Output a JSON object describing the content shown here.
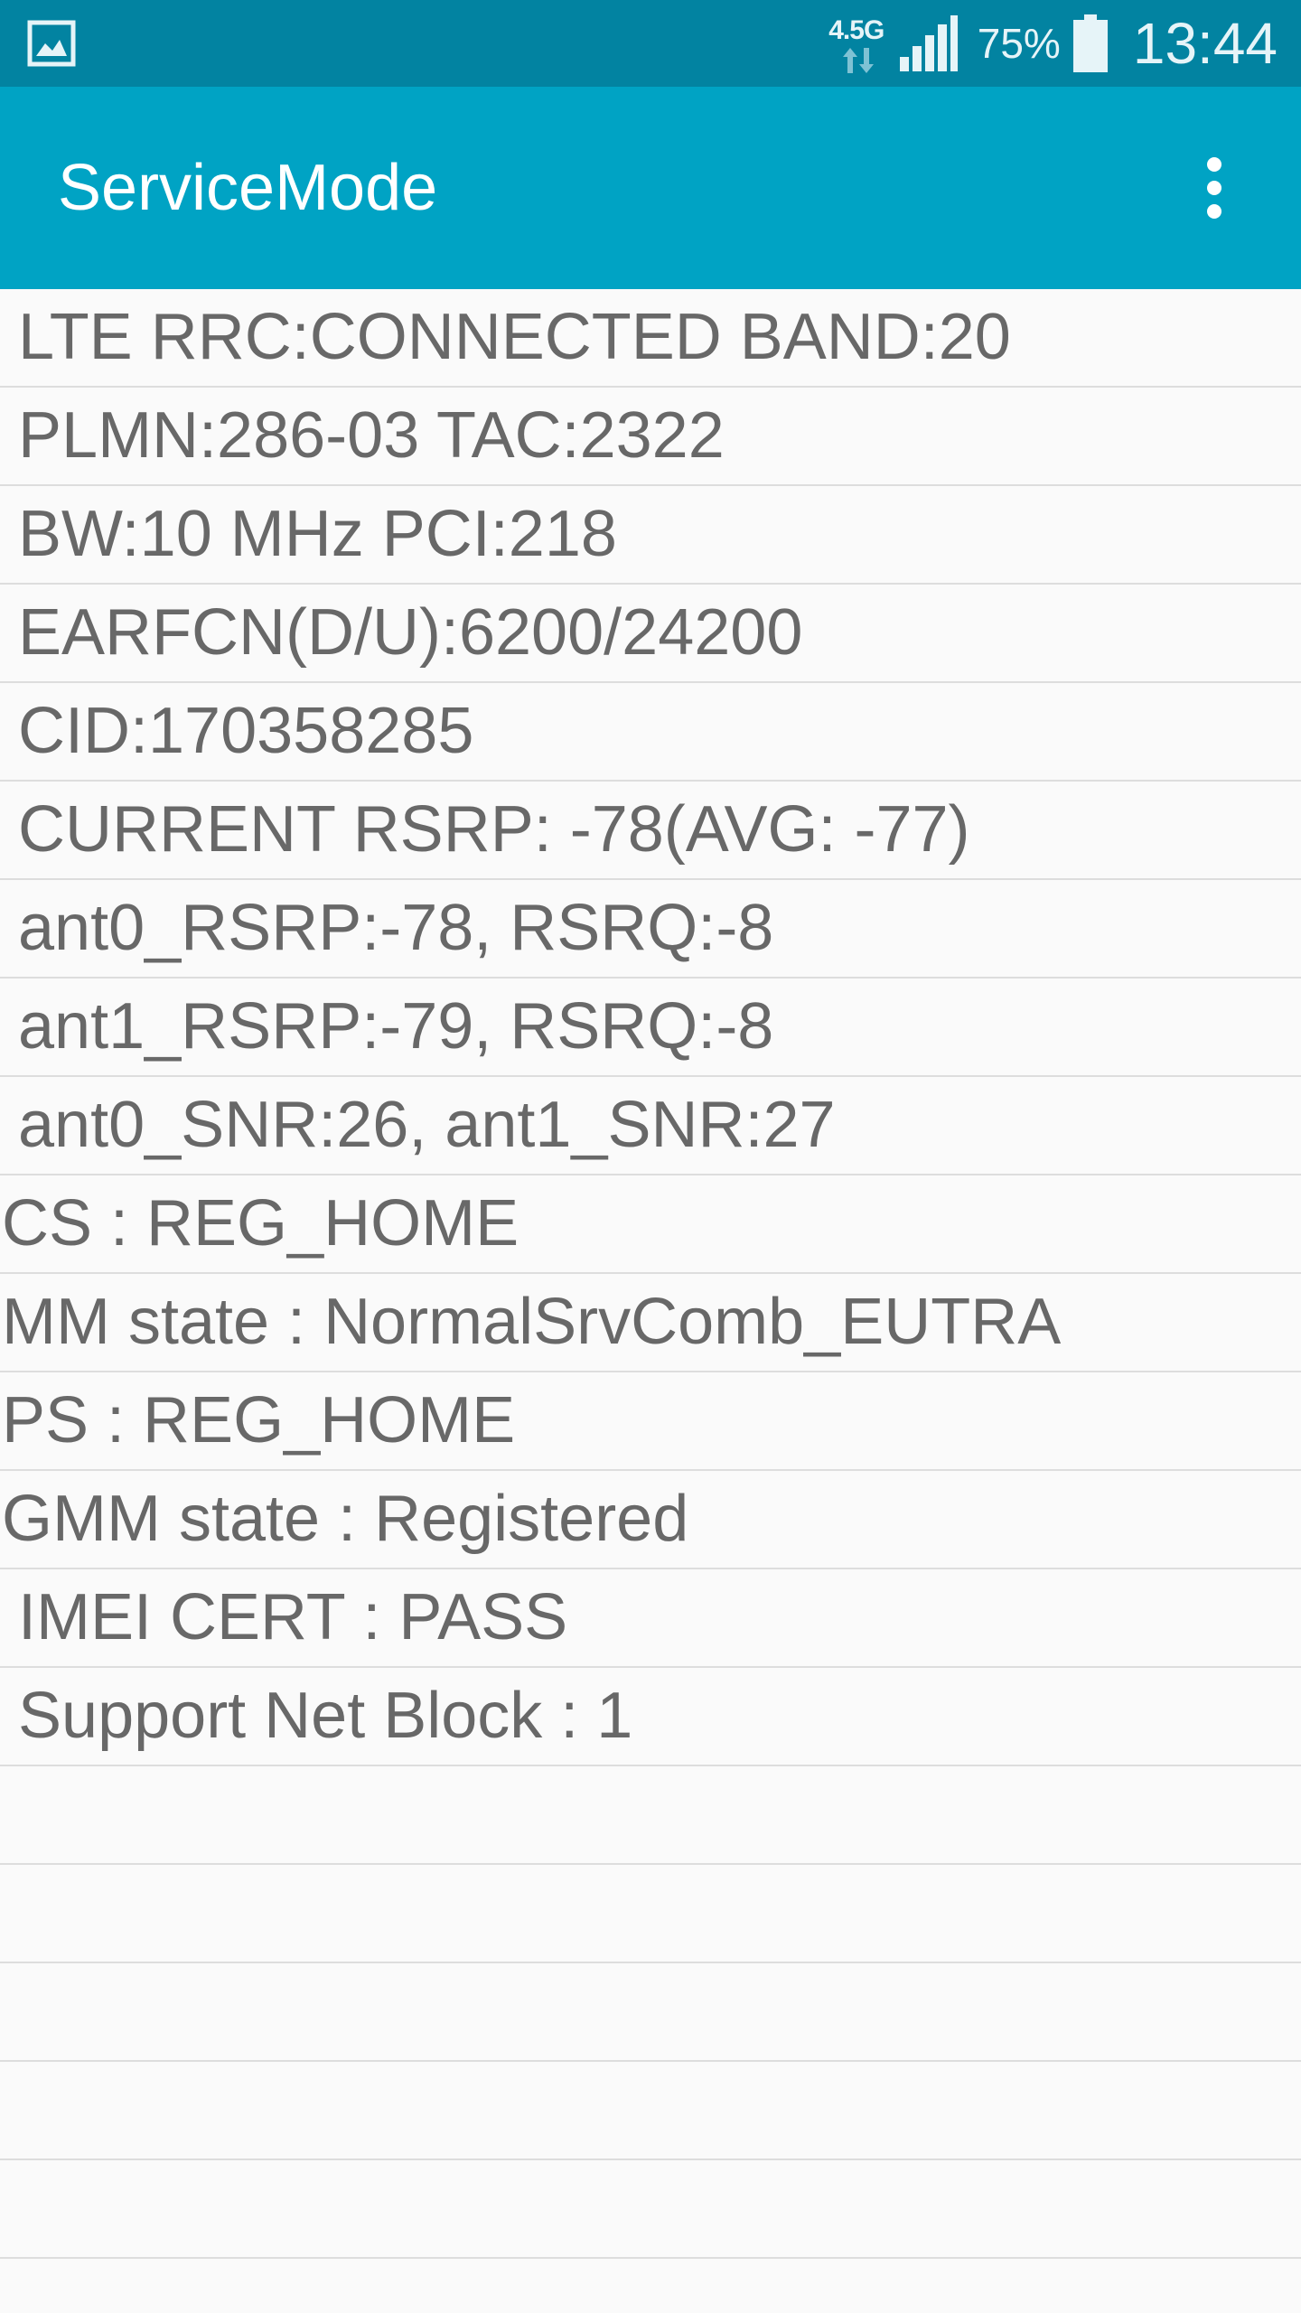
{
  "status_bar": {
    "network_type": "4.5G",
    "battery_percent": "75%",
    "time": "13:44",
    "icons": [
      "gallery-icon",
      "data-arrows-icon",
      "signal-icon",
      "battery-icon"
    ]
  },
  "app_bar": {
    "title": "ServiceMode",
    "menu_icon": "more-vert-icon",
    "background": "#00a3c4"
  },
  "rows": [
    {
      "text": "LTE RRC:CONNECTED BAND:20"
    },
    {
      "text": "PLMN:286-03 TAC:2322"
    },
    {
      "text": "BW:10 MHz PCI:218"
    },
    {
      "text": "EARFCN(D/U):6200/24200"
    },
    {
      "text": "CID:170358285"
    },
    {
      "text": "CURRENT RSRP: -78(AVG: -77)"
    },
    {
      "text": "ant0_RSRP:-78, RSRQ:-8"
    },
    {
      "text": "ant1_RSRP:-79, RSRQ:-8"
    },
    {
      "text": "ant0_SNR:26, ant1_SNR:27"
    },
    {
      "text": "CS : REG_HOME"
    },
    {
      "text": "MM state : NormalSrvComb_EUTRA"
    },
    {
      "text": "PS : REG_HOME"
    },
    {
      "text": "GMM state : Registered"
    },
    {
      "text": "IMEI CERT : PASS"
    },
    {
      "text": "Support Net Block : 1"
    },
    {
      "text": ""
    },
    {
      "text": ""
    },
    {
      "text": ""
    },
    {
      "text": ""
    },
    {
      "text": ""
    }
  ]
}
